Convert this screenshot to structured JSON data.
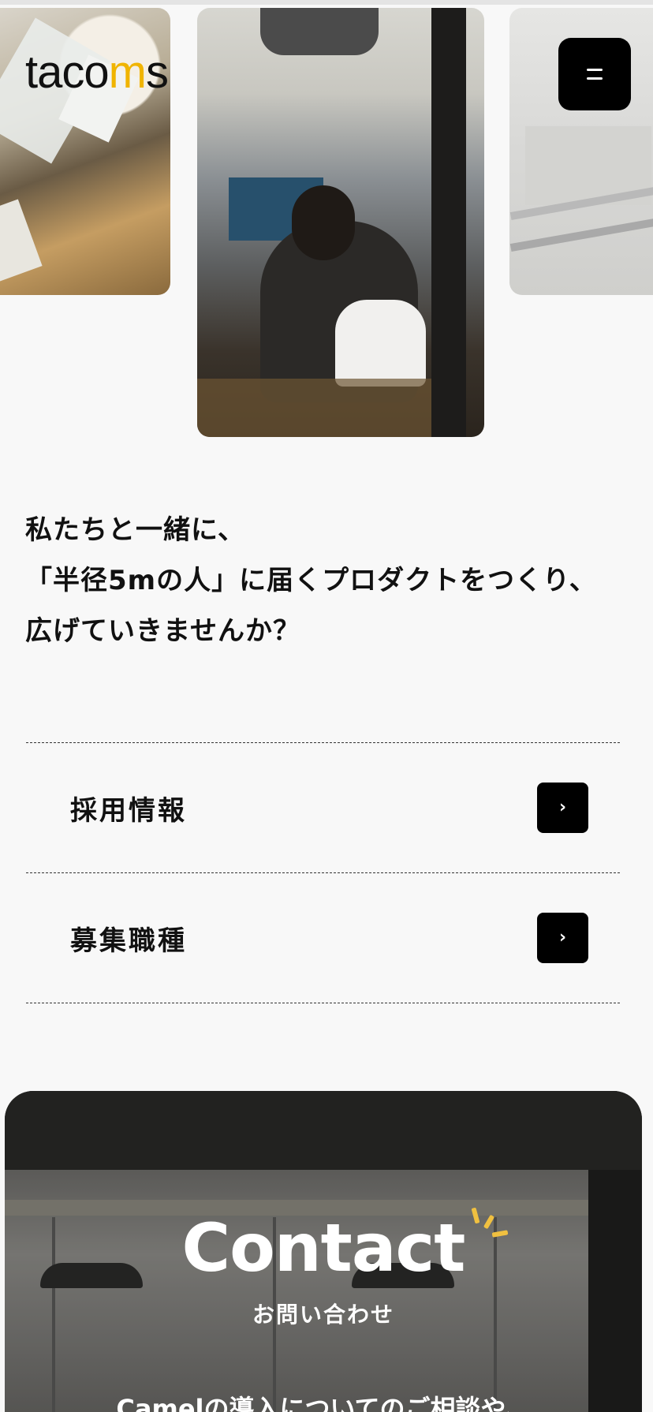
{
  "header": {
    "logo_prefix": "taco",
    "logo_dot": "m",
    "logo_suffix": "s",
    "menu_icon": "hamburger-icon"
  },
  "hero": {
    "photos": [
      "sticky-notes-photo",
      "office-worker-photo",
      "office-interior-photo"
    ]
  },
  "message": {
    "lines": [
      "私たちと一緒に、",
      "「半径5mの人」に届くプロダクトをつくり、",
      "広げていきませんか？"
    ]
  },
  "links": [
    {
      "label": "採用情報",
      "icon": "chevron-right-icon"
    },
    {
      "label": "募集職種",
      "icon": "chevron-right-icon"
    }
  ],
  "contact": {
    "title": "Contact",
    "subtitle": "お問い合わせ",
    "text": "Camelの導入についてのご相談や、",
    "accent_color": "#f0c040"
  }
}
